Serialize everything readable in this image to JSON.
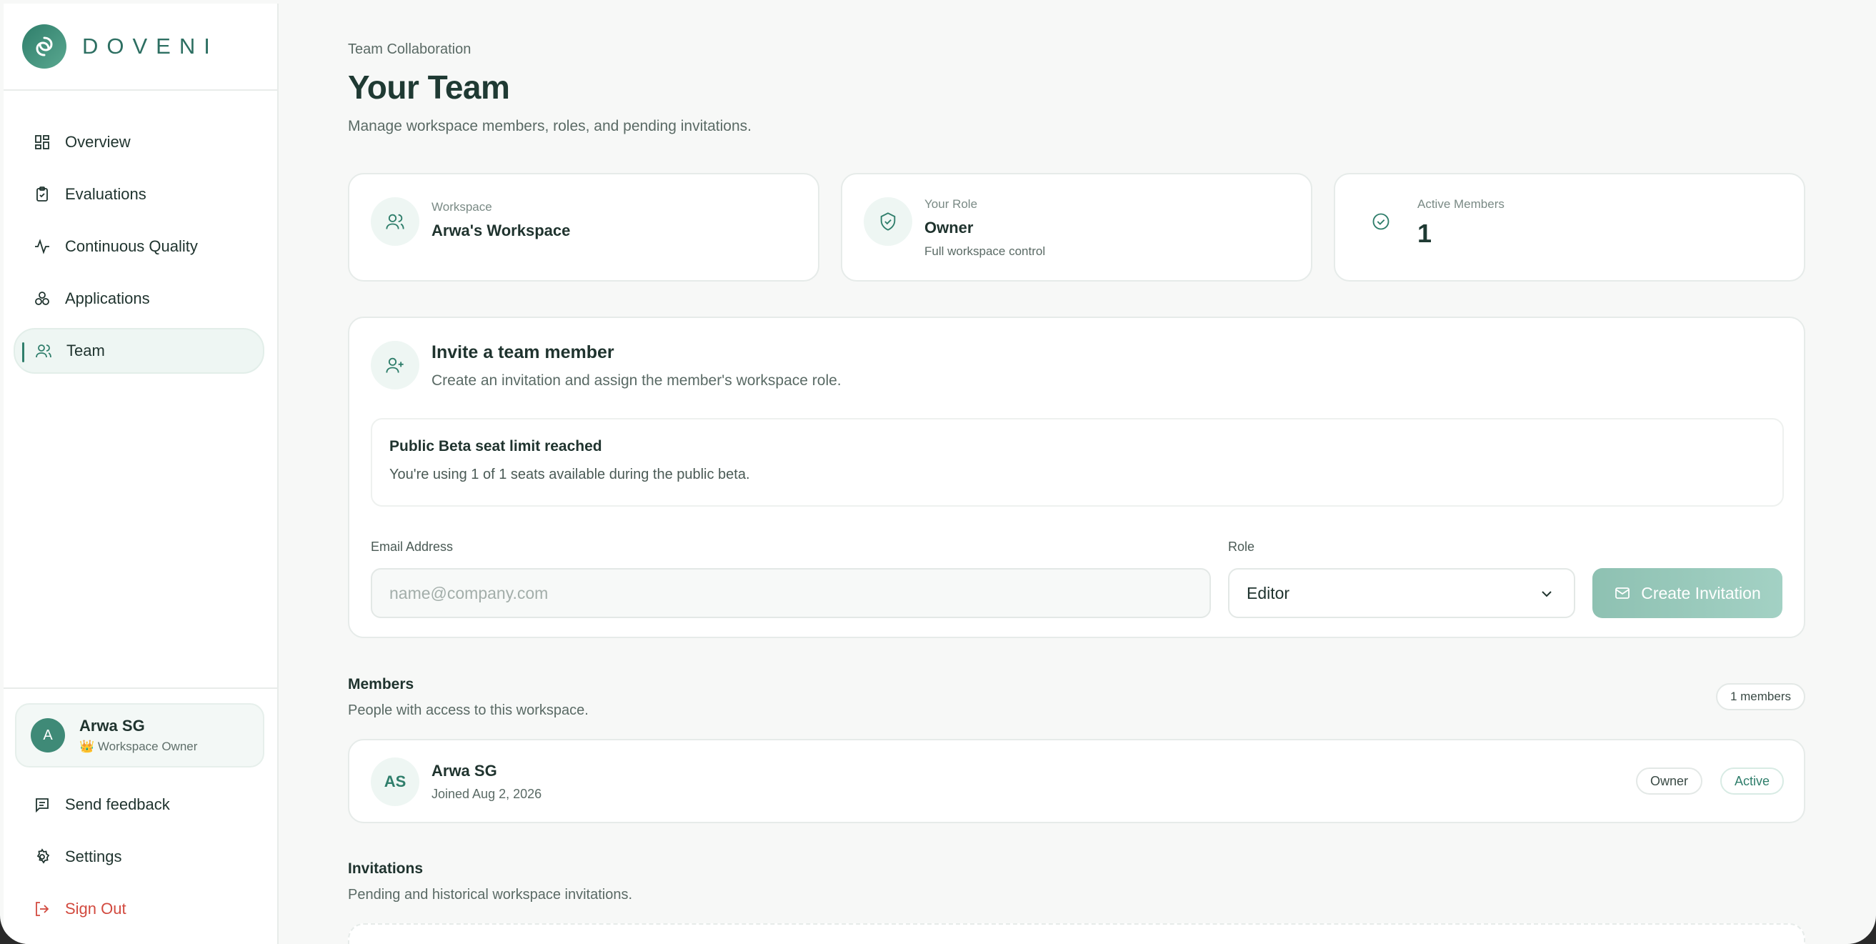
{
  "brand": {
    "name": "DOVENI",
    "accent": "#2f7e6b"
  },
  "sidebar": {
    "items": [
      {
        "label": "Overview",
        "icon": "dashboard-icon"
      },
      {
        "label": "Evaluations",
        "icon": "clipboard-check-icon"
      },
      {
        "label": "Continuous Quality",
        "icon": "activity-icon"
      },
      {
        "label": "Applications",
        "icon": "apps-icon"
      },
      {
        "label": "Team",
        "icon": "users-icon",
        "active": true
      }
    ],
    "user": {
      "initial": "A",
      "name": "Arwa SG",
      "role": "👑 Workspace Owner"
    },
    "bottom": [
      {
        "label": "Send feedback",
        "icon": "message-square-icon"
      },
      {
        "label": "Settings",
        "icon": "gear-icon"
      },
      {
        "label": "Sign Out",
        "icon": "sign-out-icon"
      }
    ]
  },
  "header": {
    "eyebrow": "Team Collaboration",
    "title": "Your Team",
    "subtitle": "Manage workspace members, roles, and pending invitations."
  },
  "stats": {
    "workspace": {
      "label": "Workspace",
      "value": "Arwa's Workspace"
    },
    "role": {
      "label": "Your Role",
      "value": "Owner",
      "hint": "Full workspace control"
    },
    "members": {
      "label": "Active Members",
      "value": "1"
    }
  },
  "invite": {
    "title": "Invite a team member",
    "subtitle": "Create an invitation and assign the member's workspace role.",
    "notice_title": "Public Beta seat limit reached",
    "notice_body": "You're using 1 of 1 seats available during the public beta.",
    "email_label": "Email Address",
    "email_placeholder": "name@company.com",
    "role_label": "Role",
    "role_value": "Editor",
    "button_label": "Create Invitation"
  },
  "members": {
    "title": "Members",
    "subtitle": "People with access to this workspace.",
    "count_label": "1 members",
    "list": [
      {
        "initials": "AS",
        "name": "Arwa SG",
        "joined": "Joined Aug 2, 2026",
        "role": "Owner",
        "status": "Active"
      }
    ]
  },
  "invitations": {
    "title": "Invitations",
    "subtitle": "Pending and historical workspace invitations."
  }
}
